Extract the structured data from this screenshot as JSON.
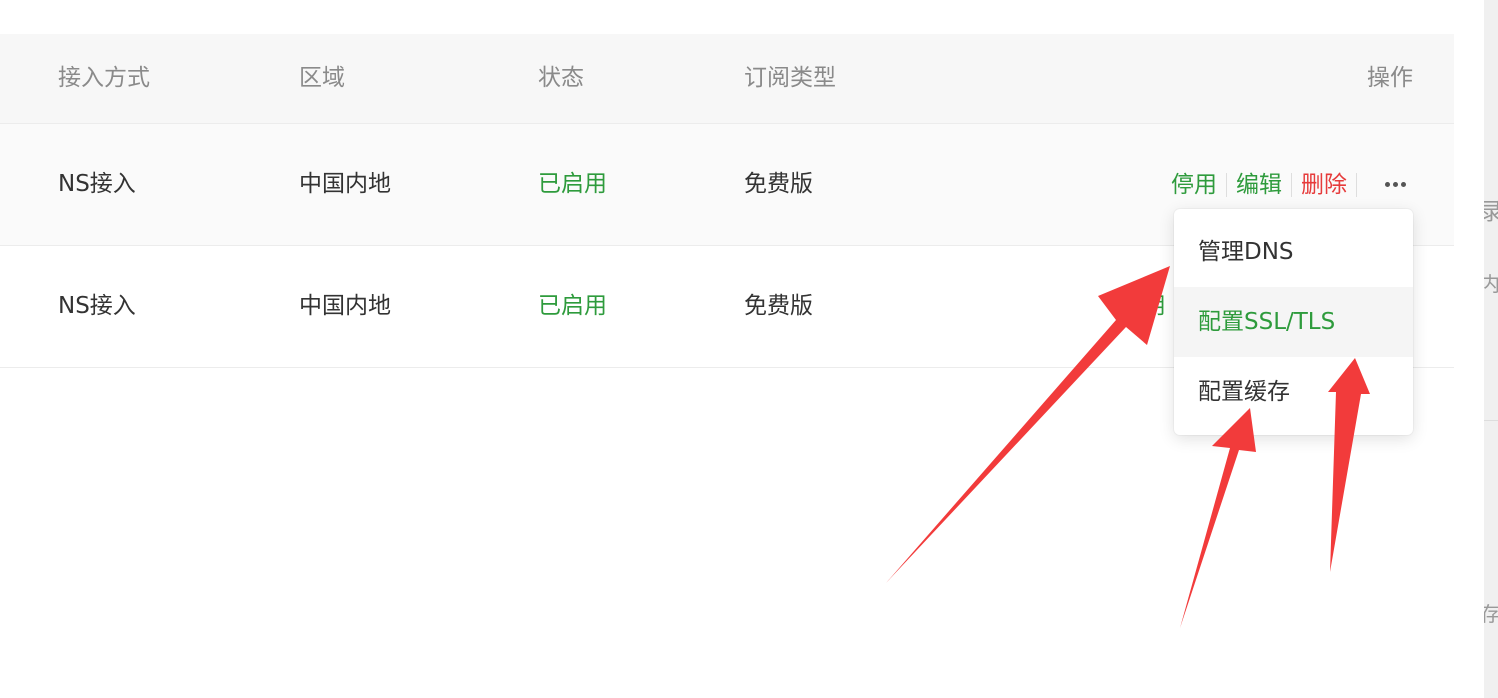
{
  "table": {
    "headers": {
      "access": "接入方式",
      "region": "区域",
      "status": "状态",
      "subscription": "订阅类型",
      "actions": "操作"
    },
    "rows": [
      {
        "access": "NS接入",
        "region": "中国内地",
        "status": "已启用",
        "subscription": "免费版",
        "actions": {
          "disable": "停用",
          "edit": "编辑",
          "delete": "删除"
        }
      },
      {
        "access": "NS接入",
        "region": "中国内地",
        "status": "已启用",
        "subscription": "免费版",
        "actions": {
          "partial": "用"
        }
      }
    ]
  },
  "dropdown": {
    "items": [
      {
        "label": "管理DNS"
      },
      {
        "label": "配置SSL/TLS"
      },
      {
        "label": "配置缓存"
      }
    ]
  },
  "right_panel": {
    "glyphs": [
      "录",
      "内",
      "存"
    ]
  },
  "colors": {
    "accent_green": "#2e9b3c",
    "danger_red": "#e63b3b",
    "annotation_red": "#f23b3b"
  }
}
